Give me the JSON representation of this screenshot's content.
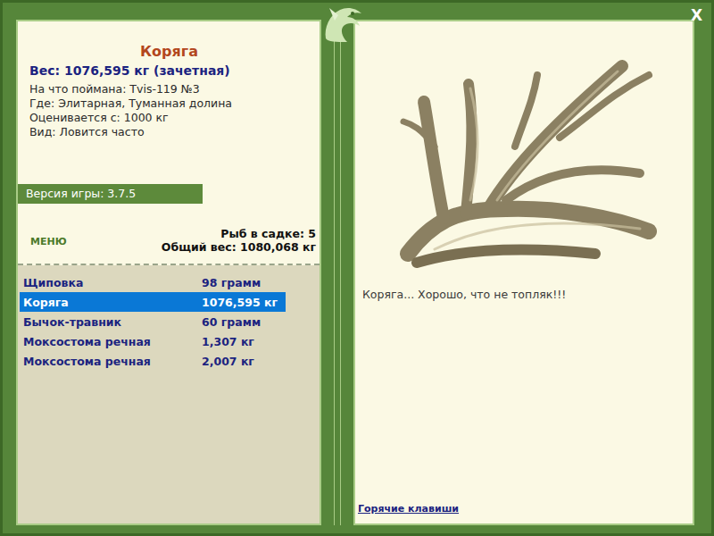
{
  "window": {
    "close": "X"
  },
  "catch": {
    "title": "Коряга",
    "weight": "Вес: 1076,595 кг (зачетная)",
    "details": [
      "На что поймана: Tvis-119 №3",
      "Где: Элитарная, Туманная долина",
      "Оценивается с: 1000 кг",
      "Вид: Ловится часто"
    ]
  },
  "version": "Версия игры: 3.7.5",
  "menu": "МЕНЮ",
  "keepnet": {
    "count": "Рыб в садке: 5",
    "total": "Общий вес: 1080,068 кг"
  },
  "fish": [
    {
      "name": "Щиповка",
      "weight": "98 грамм",
      "selected": false
    },
    {
      "name": "Коряга",
      "weight": "1076,595 кг",
      "selected": true
    },
    {
      "name": "Бычок-травник",
      "weight": "60 грамм",
      "selected": false
    },
    {
      "name": "Моксостома речная",
      "weight": "1,307 кг",
      "selected": false
    },
    {
      "name": "Моксостома речная",
      "weight": "2,007 кг",
      "selected": false
    }
  ],
  "description": "Коряга... Хорошо, что не топляк!!!",
  "hotkeys": "Горячие клавиши"
}
